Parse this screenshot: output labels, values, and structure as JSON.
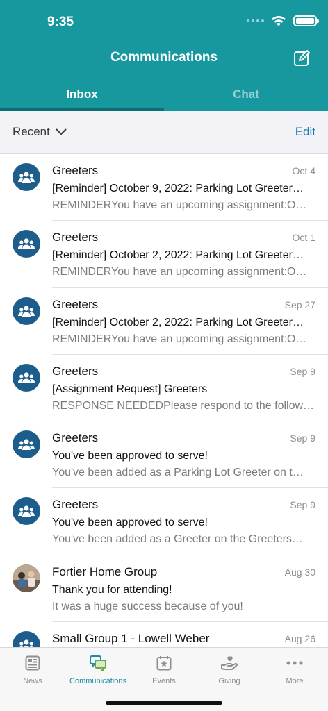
{
  "status_bar": {
    "time": "9:35"
  },
  "nav": {
    "title": "Communications",
    "compose_icon": "compose-icon"
  },
  "tabs": [
    {
      "label": "Inbox",
      "active": true
    },
    {
      "label": "Chat",
      "active": false
    }
  ],
  "filter": {
    "recent_label": "Recent",
    "edit_label": "Edit"
  },
  "messages": [
    {
      "sender": "Greeters",
      "date": "Oct 4",
      "subject": "[Reminder] October 9, 2022: Parking Lot Greeter…",
      "preview": "REMINDERYou have an upcoming assignment:O…",
      "avatar": "group-icon"
    },
    {
      "sender": "Greeters",
      "date": "Oct 1",
      "subject": "[Reminder] October 2, 2022: Parking Lot Greeter…",
      "preview": "REMINDERYou have an upcoming assignment:O…",
      "avatar": "group-icon"
    },
    {
      "sender": "Greeters",
      "date": "Sep 27",
      "subject": "[Reminder] October 2, 2022: Parking Lot Greeter…",
      "preview": "REMINDERYou have an upcoming assignment:O…",
      "avatar": "group-icon"
    },
    {
      "sender": "Greeters",
      "date": "Sep 9",
      "subject": "[Assignment Request] Greeters",
      "preview": "RESPONSE NEEDEDPlease respond to the follow…",
      "avatar": "group-icon"
    },
    {
      "sender": "Greeters",
      "date": "Sep 9",
      "subject": "You've been approved to serve!",
      "preview": "You've been added as a Parking Lot Greeter on t…",
      "avatar": "group-icon"
    },
    {
      "sender": "Greeters",
      "date": "Sep 9",
      "subject": "You've been approved to serve!",
      "preview": "You've been added as a Greeter on the Greeters…",
      "avatar": "group-icon"
    },
    {
      "sender": "Fortier Home Group",
      "date": "Aug 30",
      "subject": "Thank you for attending!",
      "preview": "It was a huge success because of you!",
      "avatar": "photo"
    },
    {
      "sender": "Small Group 1 - Lowell Weber",
      "date": "Aug 26",
      "subject": "",
      "preview": "",
      "avatar": "group-icon"
    }
  ],
  "bottom_tabs": [
    {
      "label": "News",
      "icon": "news-icon",
      "active": false
    },
    {
      "label": "Communications",
      "icon": "chat-bubbles-icon",
      "active": true
    },
    {
      "label": "Events",
      "icon": "calendar-star-icon",
      "active": false
    },
    {
      "label": "Giving",
      "icon": "giving-hand-icon",
      "active": false
    },
    {
      "label": "More",
      "icon": "more-dots-icon",
      "active": false
    }
  ],
  "colors": {
    "header": "#17989f",
    "avatar": "#1d5d8c",
    "link": "#1a7fae",
    "active_tab": "#1a8ea8"
  }
}
